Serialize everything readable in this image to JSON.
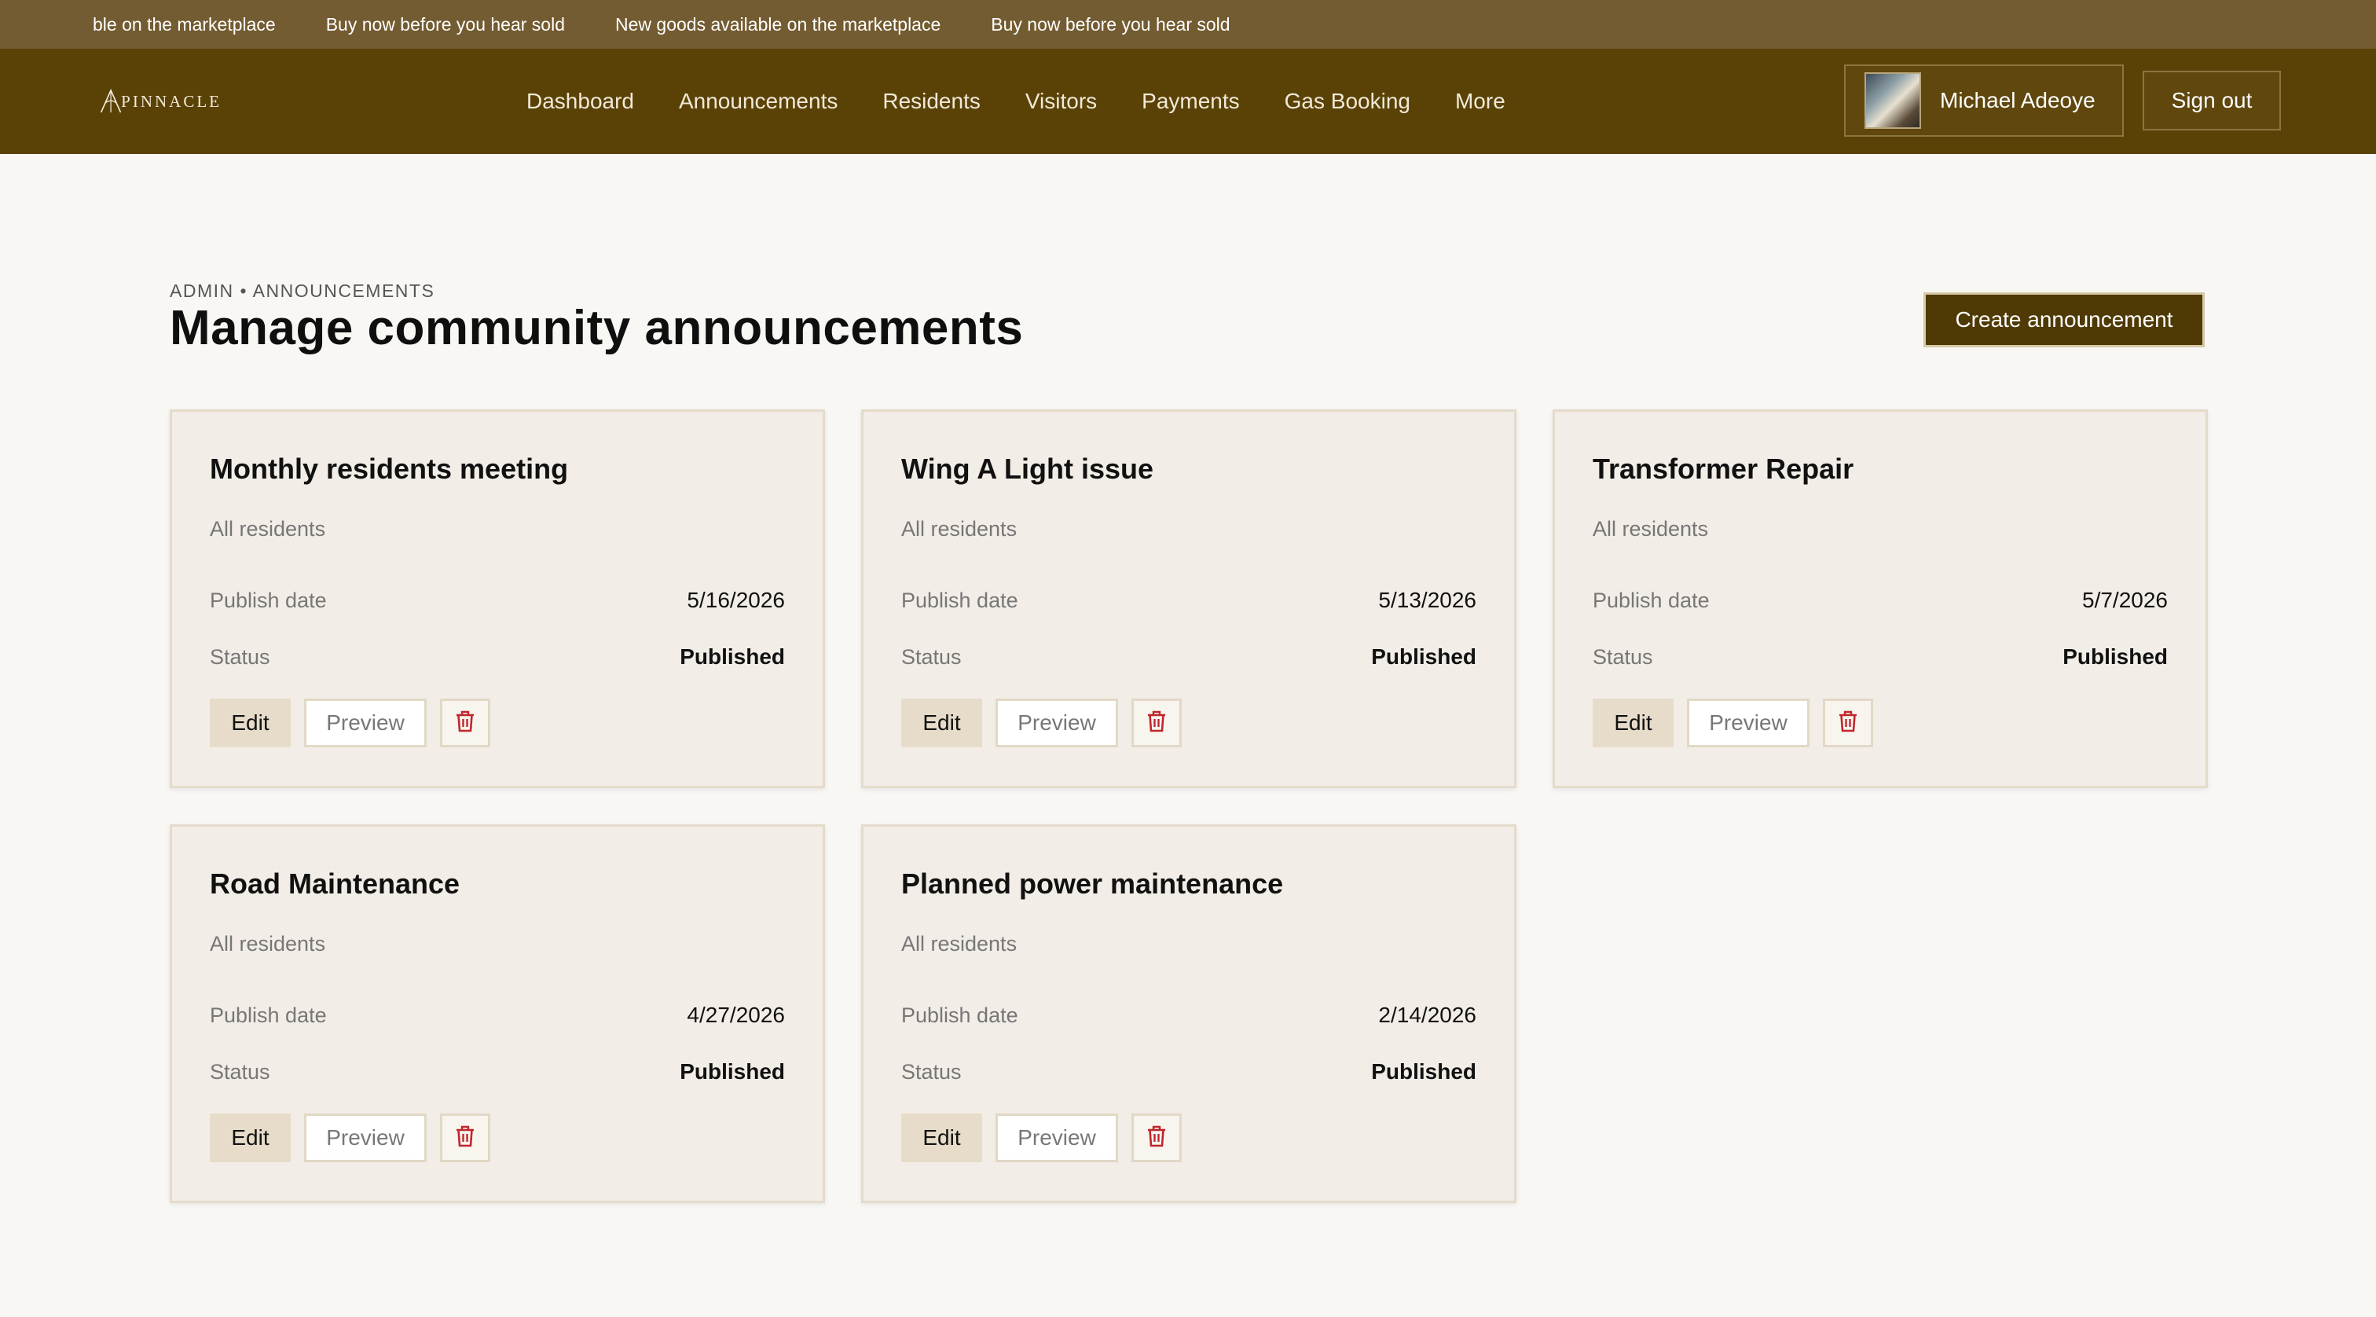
{
  "ticker": {
    "items": [
      "ble on the marketplace",
      "Buy now before you hear sold",
      "New goods available on the marketplace",
      "Buy now before you hear sold"
    ]
  },
  "brand": {
    "logo_text": "PINNACLE",
    "logo_icon": "pinnacle-logo-icon"
  },
  "nav": {
    "links": [
      "Dashboard",
      "Announcements",
      "Residents",
      "Visitors",
      "Payments",
      "Gas Booking",
      "More"
    ]
  },
  "user": {
    "name": "Michael Adeoye",
    "avatar_icon": "user-avatar"
  },
  "signout_label": "Sign out",
  "header": {
    "breadcrumb": "ADMIN • ANNOUNCEMENTS",
    "title": "Manage community announcements",
    "create_label": "Create announcement"
  },
  "labels": {
    "publish_date": "Publish date",
    "status": "Status",
    "edit": "Edit",
    "preview": "Preview",
    "delete_icon": "trash-icon"
  },
  "colors": {
    "brand": "#5a4207",
    "ticker": "#735c31",
    "danger": "#c0262d",
    "card_bg": "#f2ede6"
  },
  "announcements": [
    {
      "title": "Monthly residents meeting",
      "audience": "All residents",
      "publish_date": "5/16/2026",
      "status": "Published"
    },
    {
      "title": "Wing A Light issue",
      "audience": "All residents",
      "publish_date": "5/13/2026",
      "status": "Published"
    },
    {
      "title": "Transformer Repair",
      "audience": "All residents",
      "publish_date": "5/7/2026",
      "status": "Published"
    },
    {
      "title": "Road Maintenance",
      "audience": "All residents",
      "publish_date": "4/27/2026",
      "status": "Published"
    },
    {
      "title": "Planned power maintenance",
      "audience": "All residents",
      "publish_date": "2/14/2026",
      "status": "Published"
    }
  ]
}
